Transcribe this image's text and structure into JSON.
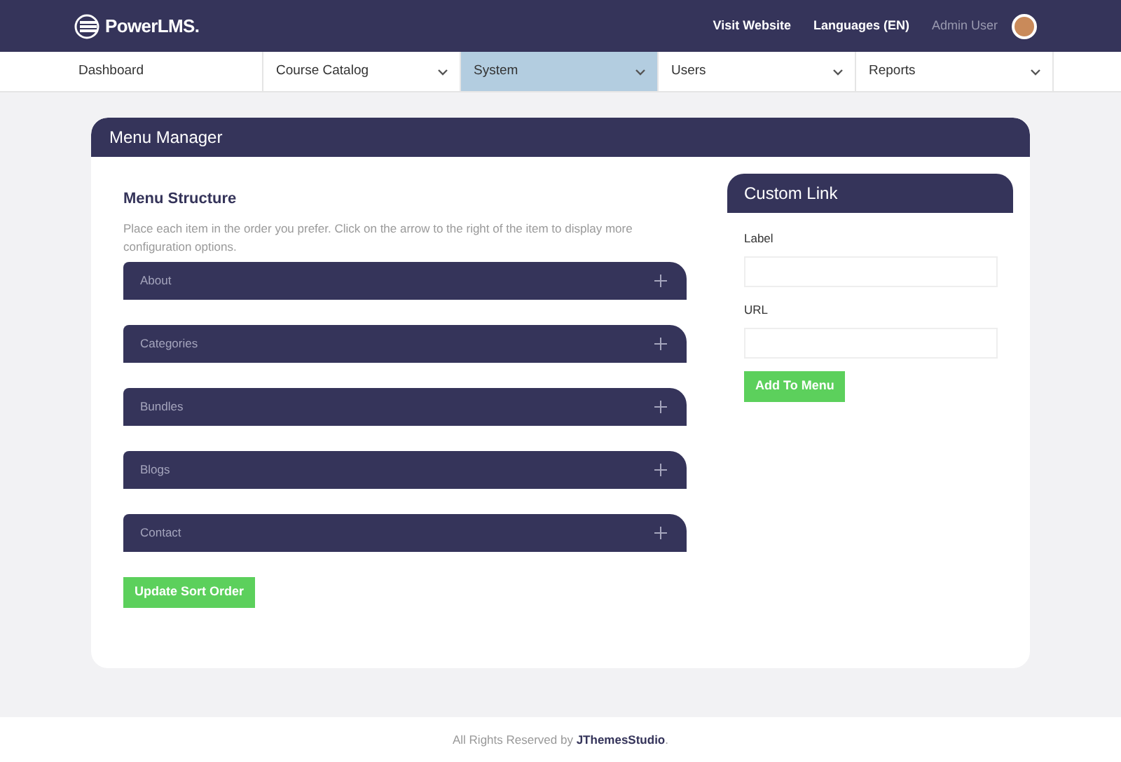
{
  "header": {
    "logo": "PowerLMS.",
    "links": [
      "Visit Website",
      "Languages (EN)"
    ],
    "user": "Admin User"
  },
  "nav": [
    {
      "label": "Dashboard",
      "dropdown": false,
      "selected": false
    },
    {
      "label": "Course Catalog",
      "dropdown": true,
      "selected": false
    },
    {
      "label": "System",
      "dropdown": true,
      "selected": true
    },
    {
      "label": "Users",
      "dropdown": true,
      "selected": false
    },
    {
      "label": "Reports",
      "dropdown": true,
      "selected": false
    }
  ],
  "card": {
    "title": "Menu Manager",
    "structure": {
      "title": "Menu Structure",
      "hint": "Place each item in the order you prefer. Click on the arrow to the right of the item to display more configuration options.",
      "items": [
        {
          "label": "About"
        },
        {
          "label": "Categories"
        },
        {
          "label": "Bundles"
        },
        {
          "label": "Blogs"
        },
        {
          "label": "Contact"
        }
      ],
      "button": "Update Sort Order"
    },
    "custom_link": {
      "title": "Custom Link",
      "fields": [
        {
          "label": "Label"
        },
        {
          "label": "URL"
        }
      ],
      "button": "Add To Menu"
    }
  },
  "footer": "All Rights Reserved by **JThemesStudio**."
}
